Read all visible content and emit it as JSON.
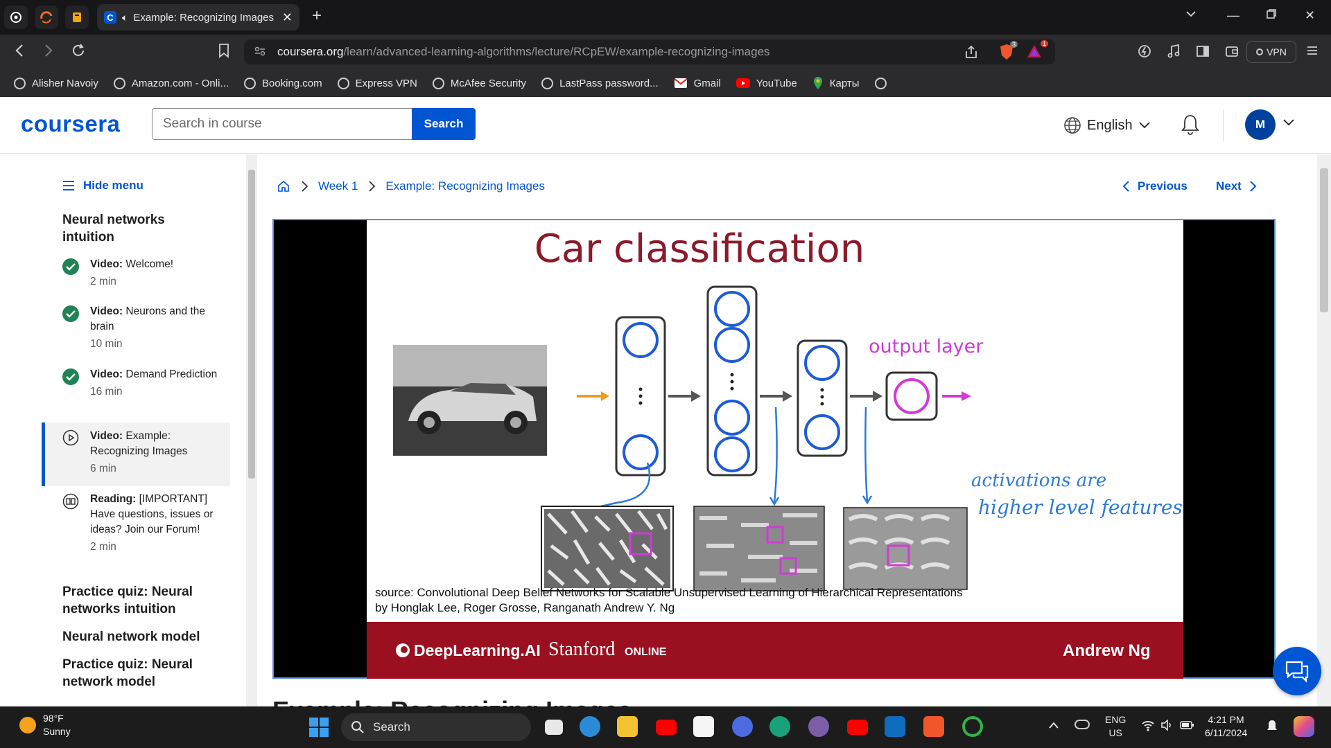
{
  "browser": {
    "tab_title": "Example: Recognizing Images",
    "url_host": "coursera.org",
    "url_path": "/learn/advanced-learning-algorithms/lecture/RCpEW/example-recognizing-images",
    "vpn_label": "VPN",
    "badge_shields": "3",
    "badge_alerts": "1",
    "bookmarks": [
      {
        "label": "Alisher Navoiy",
        "icon": "globe-icon"
      },
      {
        "label": "Amazon.com - Onli...",
        "icon": "globe-icon"
      },
      {
        "label": "Booking.com",
        "icon": "globe-icon"
      },
      {
        "label": "Express VPN",
        "icon": "globe-icon"
      },
      {
        "label": "McAfee Security",
        "icon": "globe-icon"
      },
      {
        "label": "LastPass password...",
        "icon": "globe-icon"
      },
      {
        "label": "Gmail",
        "icon": "gmail-icon"
      },
      {
        "label": "YouTube",
        "icon": "youtube-icon"
      },
      {
        "label": "Карты",
        "icon": "maps-icon"
      }
    ]
  },
  "header": {
    "logo": "coursera",
    "search_placeholder": "Search in course",
    "search_button": "Search",
    "language": "English",
    "avatar_initial": "M"
  },
  "sidebar": {
    "hide_menu": "Hide menu",
    "module_title": "Neural networks intuition",
    "items": [
      {
        "type": "Video:",
        "title": "Welcome!",
        "duration": "2 min",
        "status": "completed"
      },
      {
        "type": "Video:",
        "title": "Neurons and the brain",
        "duration": "10 min",
        "status": "completed"
      },
      {
        "type": "Video:",
        "title": "Demand Prediction",
        "duration": "16 min",
        "status": "completed"
      },
      {
        "type": "Video:",
        "title": "Example: Recognizing Images",
        "duration": "6 min",
        "status": "current"
      },
      {
        "type": "Reading:",
        "title": "[IMPORTANT] Have questions, issues or ideas? Join our Forum!",
        "duration": "2 min",
        "status": "reading"
      }
    ],
    "sections": [
      "Practice quiz: Neural networks intuition",
      "Neural network model",
      "Practice quiz: Neural network model"
    ]
  },
  "main": {
    "breadcrumbs": [
      "Week 1",
      "Example: Recognizing Images"
    ],
    "previous": "Previous",
    "next": "Next",
    "below_title": "Example: Recognizing Images"
  },
  "slide": {
    "title": "Car classification",
    "output_label": "output layer",
    "annotation_line1": "activations are",
    "annotation_line2": "higher level features",
    "source_line1": "source:  Convolutional Deep Belief Networks for Scalable Unsupervised Learning of Hierarchical Representations",
    "source_line2": "by Honglak Lee, Roger Grosse, Ranganath Andrew Y. Ng",
    "footer_brand1": "DeepLearning.AI",
    "footer_brand2": "Stanford",
    "footer_brand2_sub": "ONLINE",
    "footer_author": "Andrew Ng",
    "colors": {
      "title": "#8b1a2b",
      "neuron": "#1f5bd6",
      "output": "#d13ad6",
      "footer": "#9b1020",
      "arrow_in": "#f39a1e"
    }
  },
  "taskbar": {
    "temperature": "98°F",
    "weather": "Sunny",
    "search": "Search",
    "lang_top": "ENG",
    "lang_bottom": "US",
    "time": "4:21 PM",
    "date": "6/11/2024"
  }
}
